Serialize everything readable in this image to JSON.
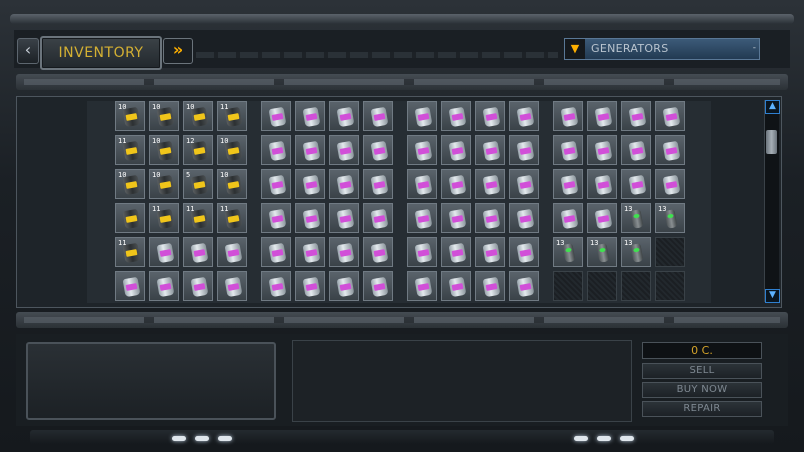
{
  "header": {
    "title": "INVENTORY",
    "back_glyph": "‹",
    "forward_glyph": "»"
  },
  "filter": {
    "selected": "GENERATORS",
    "arrow_glyph": "▼",
    "caret_glyph": "-"
  },
  "scroll": {
    "up_glyph": "▲",
    "down_glyph": "▼"
  },
  "shop": {
    "price": "0 C.",
    "sell_label": "SELL",
    "buy_label": "BUY NOW",
    "repair_label": "REPAIR"
  },
  "inventory": {
    "panels": [
      {
        "rows": [
          [
            {
              "t": "gold",
              "l": "10"
            },
            {
              "t": "gold",
              "l": "10"
            },
            {
              "t": "gold",
              "l": "10"
            },
            {
              "t": "gold",
              "l": "11"
            }
          ],
          [
            {
              "t": "gold",
              "l": "11"
            },
            {
              "t": "gold",
              "l": "10"
            },
            {
              "t": "gold",
              "l": "12"
            },
            {
              "t": "gold",
              "l": "10"
            }
          ],
          [
            {
              "t": "gold",
              "l": "10"
            },
            {
              "t": "gold",
              "l": "10"
            },
            {
              "t": "gold",
              "l": "5"
            },
            {
              "t": "gold",
              "l": "10"
            }
          ],
          [
            {
              "t": "gold",
              "l": ""
            },
            {
              "t": "gold",
              "l": "11"
            },
            {
              "t": "gold",
              "l": "11"
            },
            {
              "t": "gold",
              "l": "11"
            }
          ],
          [
            {
              "t": "gold",
              "l": "11"
            },
            {
              "t": "pink",
              "l": ""
            },
            {
              "t": "pink",
              "l": ""
            },
            {
              "t": "pink",
              "l": ""
            }
          ],
          [
            {
              "t": "pink",
              "l": ""
            },
            {
              "t": "pink",
              "l": ""
            },
            {
              "t": "pink",
              "l": ""
            },
            {
              "t": "pink",
              "l": ""
            }
          ]
        ]
      },
      {
        "rows": [
          [
            {
              "t": "pink",
              "l": ""
            },
            {
              "t": "pink",
              "l": ""
            },
            {
              "t": "pink",
              "l": ""
            },
            {
              "t": "pink",
              "l": ""
            }
          ],
          [
            {
              "t": "pink",
              "l": ""
            },
            {
              "t": "pink",
              "l": ""
            },
            {
              "t": "pink",
              "l": ""
            },
            {
              "t": "pink",
              "l": ""
            }
          ],
          [
            {
              "t": "pink",
              "l": ""
            },
            {
              "t": "pink",
              "l": ""
            },
            {
              "t": "pink",
              "l": ""
            },
            {
              "t": "pink",
              "l": ""
            }
          ],
          [
            {
              "t": "pink",
              "l": ""
            },
            {
              "t": "pink",
              "l": ""
            },
            {
              "t": "pink",
              "l": ""
            },
            {
              "t": "pink",
              "l": ""
            }
          ],
          [
            {
              "t": "pink",
              "l": ""
            },
            {
              "t": "pink",
              "l": ""
            },
            {
              "t": "pink",
              "l": ""
            },
            {
              "t": "pink",
              "l": ""
            }
          ],
          [
            {
              "t": "pink",
              "l": ""
            },
            {
              "t": "pink",
              "l": ""
            },
            {
              "t": "pink",
              "l": ""
            },
            {
              "t": "pink",
              "l": ""
            }
          ]
        ]
      },
      {
        "rows": [
          [
            {
              "t": "pink",
              "l": ""
            },
            {
              "t": "pink",
              "l": ""
            },
            {
              "t": "pink",
              "l": ""
            },
            {
              "t": "pink",
              "l": ""
            }
          ],
          [
            {
              "t": "pink",
              "l": ""
            },
            {
              "t": "pink",
              "l": ""
            },
            {
              "t": "pink",
              "l": ""
            },
            {
              "t": "pink",
              "l": ""
            }
          ],
          [
            {
              "t": "pink",
              "l": ""
            },
            {
              "t": "pink",
              "l": ""
            },
            {
              "t": "pink",
              "l": ""
            },
            {
              "t": "pink",
              "l": ""
            }
          ],
          [
            {
              "t": "pink",
              "l": ""
            },
            {
              "t": "pink",
              "l": ""
            },
            {
              "t": "pink",
              "l": ""
            },
            {
              "t": "pink",
              "l": ""
            }
          ],
          [
            {
              "t": "pink",
              "l": ""
            },
            {
              "t": "pink",
              "l": ""
            },
            {
              "t": "pink",
              "l": ""
            },
            {
              "t": "pink",
              "l": ""
            }
          ],
          [
            {
              "t": "pink",
              "l": ""
            },
            {
              "t": "pink",
              "l": ""
            },
            {
              "t": "pink",
              "l": ""
            },
            {
              "t": "pink",
              "l": ""
            }
          ]
        ]
      },
      {
        "rows": [
          [
            {
              "t": "pink",
              "l": ""
            },
            {
              "t": "pink",
              "l": ""
            },
            {
              "t": "pink",
              "l": ""
            },
            {
              "t": "pink",
              "l": ""
            }
          ],
          [
            {
              "t": "pink",
              "l": ""
            },
            {
              "t": "pink",
              "l": ""
            },
            {
              "t": "pink",
              "l": ""
            },
            {
              "t": "pink",
              "l": ""
            }
          ],
          [
            {
              "t": "pink",
              "l": ""
            },
            {
              "t": "pink",
              "l": ""
            },
            {
              "t": "pink",
              "l": ""
            },
            {
              "t": "pink",
              "l": ""
            }
          ],
          [
            {
              "t": "pink",
              "l": ""
            },
            {
              "t": "pink",
              "l": ""
            },
            {
              "t": "green",
              "l": "13"
            },
            {
              "t": "green",
              "l": "13"
            }
          ],
          [
            {
              "t": "green",
              "l": "13"
            },
            {
              "t": "green",
              "l": "13"
            },
            {
              "t": "green",
              "l": "13"
            },
            {
              "t": "empty",
              "l": ""
            }
          ],
          [
            {
              "t": "empty",
              "l": ""
            },
            {
              "t": "empty",
              "l": ""
            },
            {
              "t": "empty",
              "l": ""
            },
            {
              "t": "empty",
              "l": ""
            }
          ]
        ]
      }
    ]
  }
}
